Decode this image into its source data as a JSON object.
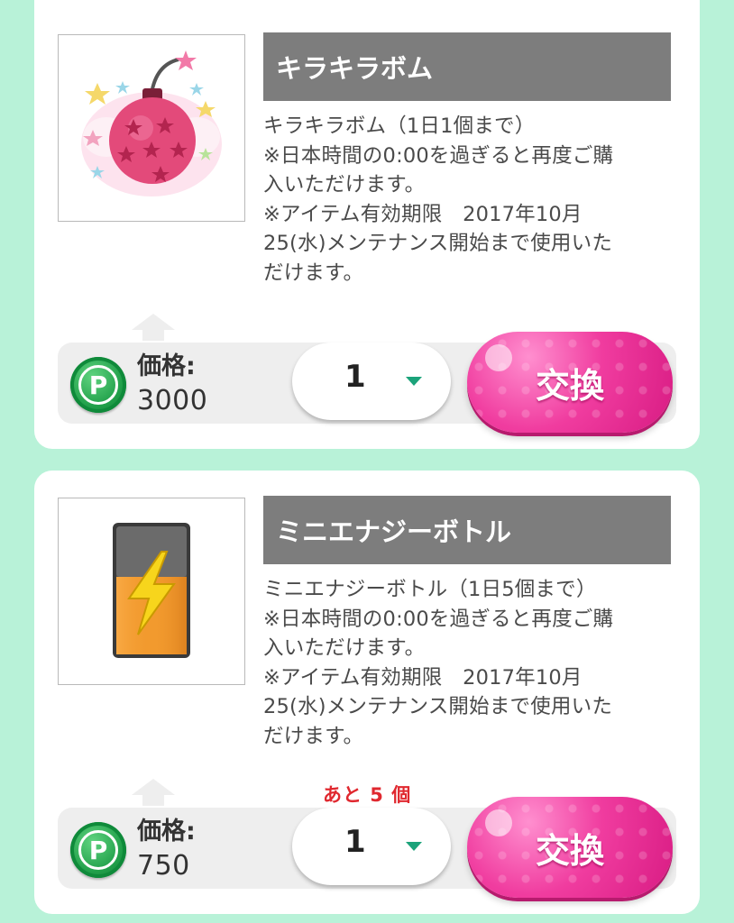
{
  "colors": {
    "background": "#b8f2d8",
    "title_bar": "#7d7d7d",
    "exchange_button": "#f03c9f",
    "remaining_text": "#e0282f",
    "caret": "#1ba37a"
  },
  "items": [
    {
      "title": "キラキラボム",
      "description": [
        "キラキラボム（1日1個まで）",
        "※日本時間の0:00を過ぎると再度ご購",
        "入いただけます。",
        "※アイテム有効期限　2017年10月",
        "25(水)メンテナンス開始まで使用いた",
        "だけます。"
      ],
      "icon": "sparkle-bomb-icon",
      "price_label": "価格:",
      "price_value": "3000",
      "quantity": "1",
      "exchange_label": "交換"
    },
    {
      "title": "ミニエナジーボトル",
      "description": [
        "ミニエナジーボトル（1日5個まで）",
        "※日本時間の0:00を過ぎると再度ご購",
        "入いただけます。",
        "※アイテム有効期限　2017年10月",
        "25(水)メンテナンス開始まで使用いた",
        "だけます。"
      ],
      "icon": "battery-energy-icon",
      "price_label": "価格:",
      "price_value": "750",
      "quantity": "1",
      "remaining": "あと 5 個",
      "exchange_label": "交換"
    }
  ],
  "points_icon_letter": "P"
}
